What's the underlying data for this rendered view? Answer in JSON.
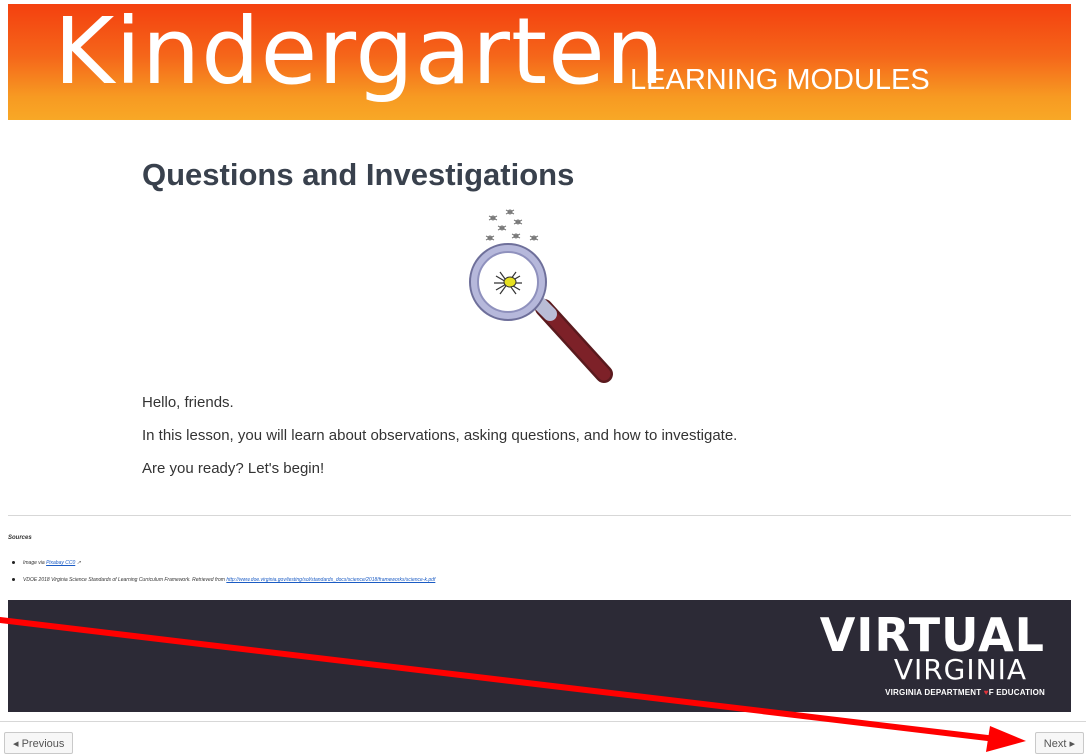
{
  "banner": {
    "title": "Kindergarten",
    "subtitle": "LEARNING MODULES"
  },
  "main": {
    "title": "Questions and Investigations",
    "image_icon": "magnifying-glass-spider-icon",
    "paragraphs": [
      "Hello, friends.",
      "In this lesson, you will learn about observations, asking questions, and how to investigate.",
      "Are you ready? Let's begin!"
    ]
  },
  "sources": {
    "heading": "Sources",
    "item1_prefix": "Image via ",
    "item1_link": "Pixabay CC0",
    "item1_icon": "external-link-icon",
    "item2_prefix": "VDOE 2018 Virginia Science Standards of Learning Curriculum Framework. Retrieved from ",
    "item2_link": "http://www.doe.virginia.gov/testing/sol/standards_docs/science/2018/frameworks/science-k.pdf"
  },
  "footer": {
    "logo_line1": "VIRTUAL",
    "logo_line2": "VIRGINIA",
    "logo_line3_a": "VIRGINIA DEPARTMENT ",
    "logo_line3_b": "F EDUCATION"
  },
  "nav": {
    "previous_label": "◂ Previous",
    "next_label": "Next ▸"
  },
  "colors": {
    "banner_top": "#f4400f",
    "banner_bottom": "#f8a826",
    "footer_bg": "#2c2a36",
    "annotation_arrow": "#ff0000"
  }
}
